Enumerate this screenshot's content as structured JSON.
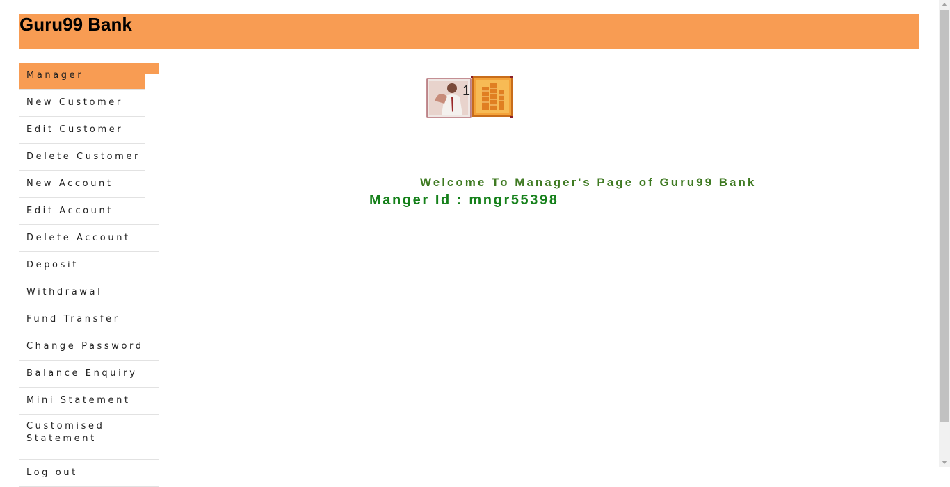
{
  "header": {
    "title": "Guru99 Bank"
  },
  "menu": {
    "items": [
      {
        "label": "Manager"
      },
      {
        "label": "New Customer"
      },
      {
        "label": "Edit Customer"
      },
      {
        "label": "Delete Customer"
      },
      {
        "label": "New Account"
      },
      {
        "label": "Edit Account"
      },
      {
        "label": "Delete Account"
      },
      {
        "label": "Deposit"
      },
      {
        "label": "Withdrawal"
      },
      {
        "label": "Fund Transfer"
      },
      {
        "label": "Change Password"
      },
      {
        "label": "Balance Enquiry"
      },
      {
        "label": "Mini Statement"
      },
      {
        "label": "Customised Statement"
      },
      {
        "label": "Log out"
      }
    ]
  },
  "main": {
    "welcome": "Welcome To Manager's Page of Guru99 Bank",
    "manager_id": "Manger Id : mngr55398"
  },
  "colors": {
    "brand": "#f89c53",
    "welcome": "#3f7a22",
    "manager_id": "#15801a"
  }
}
